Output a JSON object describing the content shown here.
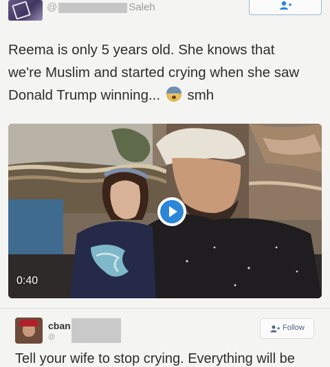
{
  "tweet": {
    "handle_prefix": "@",
    "name_visible": "Saleh",
    "text_before_emoji": "Reema is only 5 years old. She knows that we're Muslim and started crying when she saw Donald Trump winning...",
    "emoji_icon": "fearful-face-icon",
    "text_after_emoji": "smh",
    "follow_icon": "add-user-icon"
  },
  "video": {
    "duration": "0:40",
    "play_icon": "play-icon",
    "accent_color": "#2b86d8"
  },
  "reply": {
    "name": "cban",
    "handle": "@",
    "follow_label": "Follow",
    "text": "Tell your wife to stop crying. Everything will be"
  }
}
